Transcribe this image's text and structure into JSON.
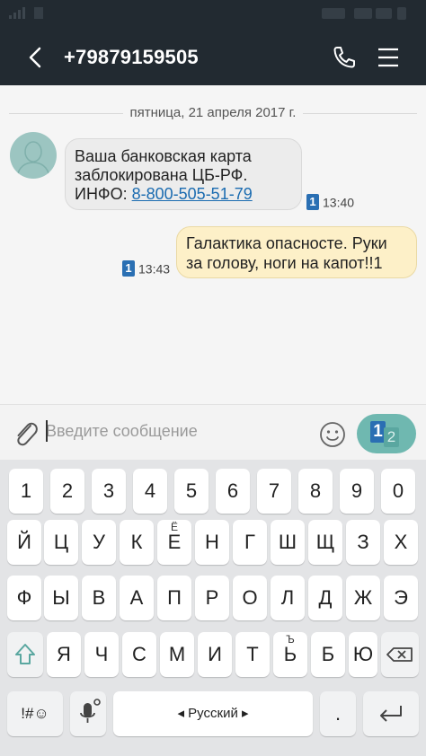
{
  "header": {
    "title": "+79879159505",
    "back_icon": "back-arrow-icon",
    "call_icon": "phone-icon",
    "menu_icon": "menu-icon"
  },
  "conversation": {
    "date_separator": "пятница, 21 апреля 2017 г.",
    "messages": [
      {
        "direction": "incoming",
        "line1": "Ваша банковская карта",
        "line2": "заблокирована ЦБ-РФ.",
        "line3_prefix": "ИНФО: ",
        "link": "8-800-505-51-79",
        "sim": "1",
        "time": "13:40"
      },
      {
        "direction": "outgoing",
        "line1": "Галактика опасносте. Руки",
        "line2": "за голову, ноги на капот!!1",
        "sim": "1",
        "time": "13:43"
      }
    ]
  },
  "compose": {
    "placeholder": "Введите сообщение",
    "send_sim_primary": "1",
    "send_sim_secondary": "2"
  },
  "keyboard": {
    "row_numbers": [
      "1",
      "2",
      "3",
      "4",
      "5",
      "6",
      "7",
      "8",
      "9",
      "0"
    ],
    "row1": [
      {
        "label": "Й"
      },
      {
        "label": "Ц"
      },
      {
        "label": "У"
      },
      {
        "label": "К"
      },
      {
        "label": "Е",
        "sup": "Ё"
      },
      {
        "label": "Н"
      },
      {
        "label": "Г"
      },
      {
        "label": "Ш"
      },
      {
        "label": "Щ"
      },
      {
        "label": "З"
      },
      {
        "label": "Х"
      }
    ],
    "row2": [
      "Ф",
      "Ы",
      "В",
      "А",
      "П",
      "Р",
      "О",
      "Л",
      "Д",
      "Ж",
      "Э"
    ],
    "row3": [
      {
        "label": "Я"
      },
      {
        "label": "Ч"
      },
      {
        "label": "С"
      },
      {
        "label": "М"
      },
      {
        "label": "И"
      },
      {
        "label": "Т"
      },
      {
        "label": "Ь",
        "sup": "Ъ"
      },
      {
        "label": "Б"
      },
      {
        "label": "Ю"
      }
    ],
    "symbols_label": "!#☺",
    "space_label": "◂  Русский  ▸",
    "period_label": "."
  },
  "colors": {
    "app_bar": "#222a31",
    "incoming_bubble": "#ececec",
    "outgoing_bubble": "#fdf0c8",
    "sim_badge": "#2a6fb3",
    "send_button": "#6fb8b0",
    "link": "#1a6bb0"
  }
}
